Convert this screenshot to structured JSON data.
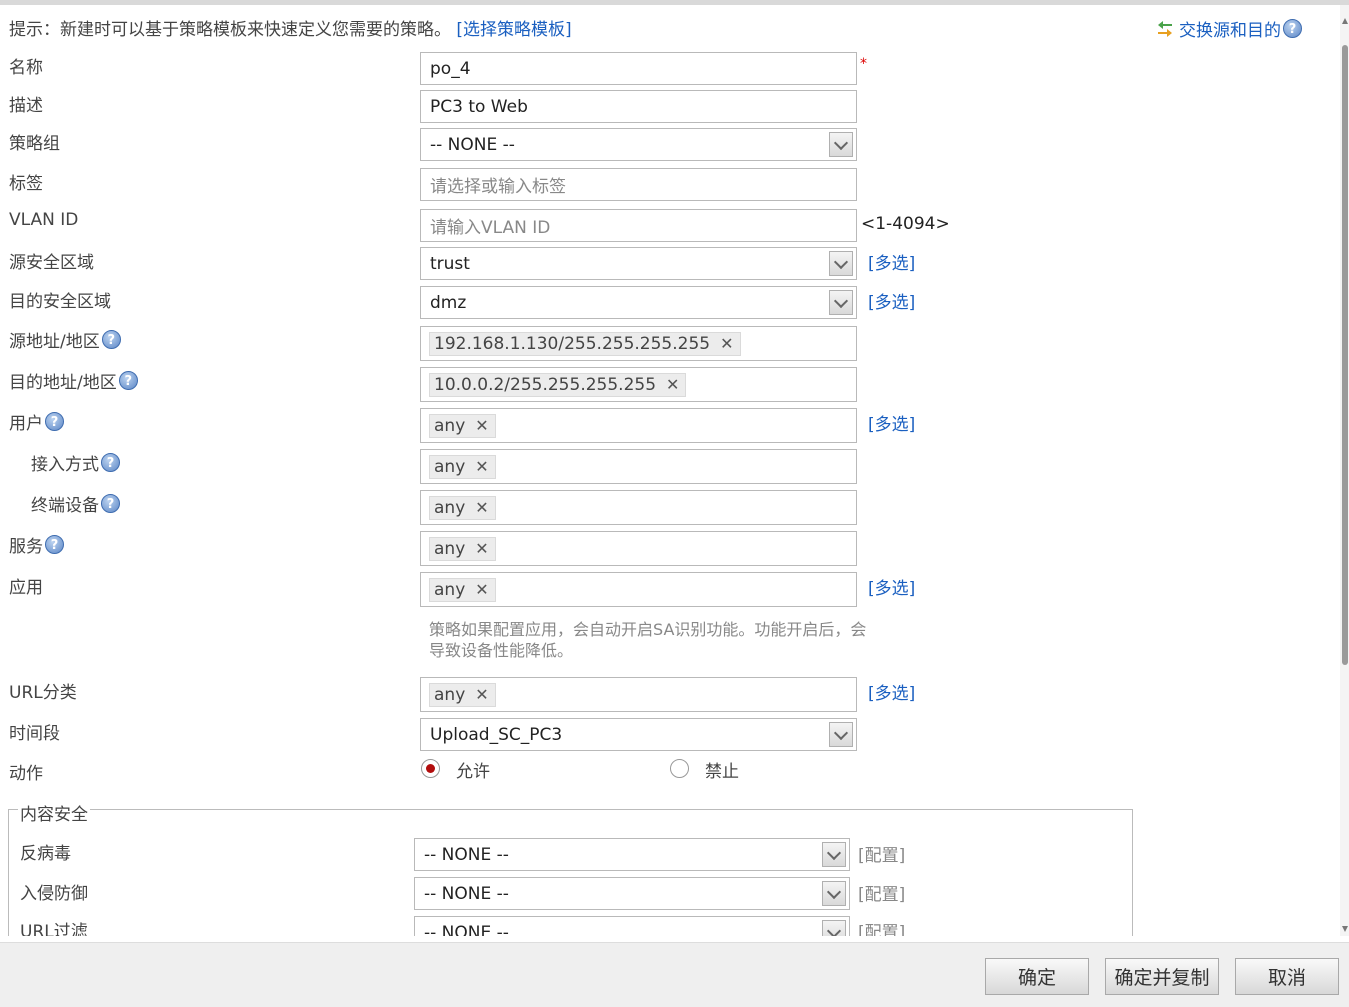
{
  "hint": {
    "text": "提示：新建时可以基于策略模板来快速定义您需要的策略。",
    "template_link": "[选择策略模板]"
  },
  "swap_link": "交换源和目的",
  "help_glyph": "?",
  "labels": {
    "name": "名称",
    "description": "描述",
    "policy_group": "策略组",
    "tag": "标签",
    "vlan_id": "VLAN ID",
    "src_zone": "源安全区域",
    "dst_zone": "目的安全区域",
    "src_addr": "源地址/地区",
    "dst_addr": "目的地址/地区",
    "user": "用户",
    "access_method": "接入方式",
    "terminal_device": "终端设备",
    "service": "服务",
    "application": "应用",
    "url_category": "URL分类",
    "time_range": "时间段",
    "action": "动作"
  },
  "fields": {
    "name": "po_4",
    "required_mark": "*",
    "description": "PC3 to Web",
    "policy_group": "-- NONE --",
    "tag_placeholder": "请选择或输入标签",
    "vlan_placeholder": "请输入VLAN ID",
    "vlan_range": "<1-4094>",
    "src_zone": "trust",
    "dst_zone": "dmz",
    "src_addr_tag": "192.168.1.130/255.255.255.255",
    "dst_addr_tag": "10.0.0.2/255.255.255.255",
    "user_tag": "any",
    "access_method_tag": "any",
    "terminal_device_tag": "any",
    "service_tag": "any",
    "application_tag": "any",
    "url_category_tag": "any",
    "time_range": "Upload_SC_PC3",
    "remove_glyph": "✕"
  },
  "multi_select": "[多选]",
  "app_note": "策略如果配置应用，会自动开启SA识别功能。功能开启后，会导致设备性能降低。",
  "action": {
    "allow": "允许",
    "deny": "禁止",
    "selected": "allow"
  },
  "content_security": {
    "legend": "内容安全",
    "configure": "[配置]",
    "rows": [
      {
        "label": "反病毒",
        "value": "-- NONE --"
      },
      {
        "label": "入侵防御",
        "value": "-- NONE --"
      },
      {
        "label": "URL过滤",
        "value": "-- NONE --"
      }
    ]
  },
  "buttons": {
    "ok": "确定",
    "ok_copy": "确定并复制",
    "cancel": "取消"
  },
  "colors": {
    "link": "#1a5fc0",
    "required": "#dd0000",
    "radio_selected": "#b20d0d"
  }
}
